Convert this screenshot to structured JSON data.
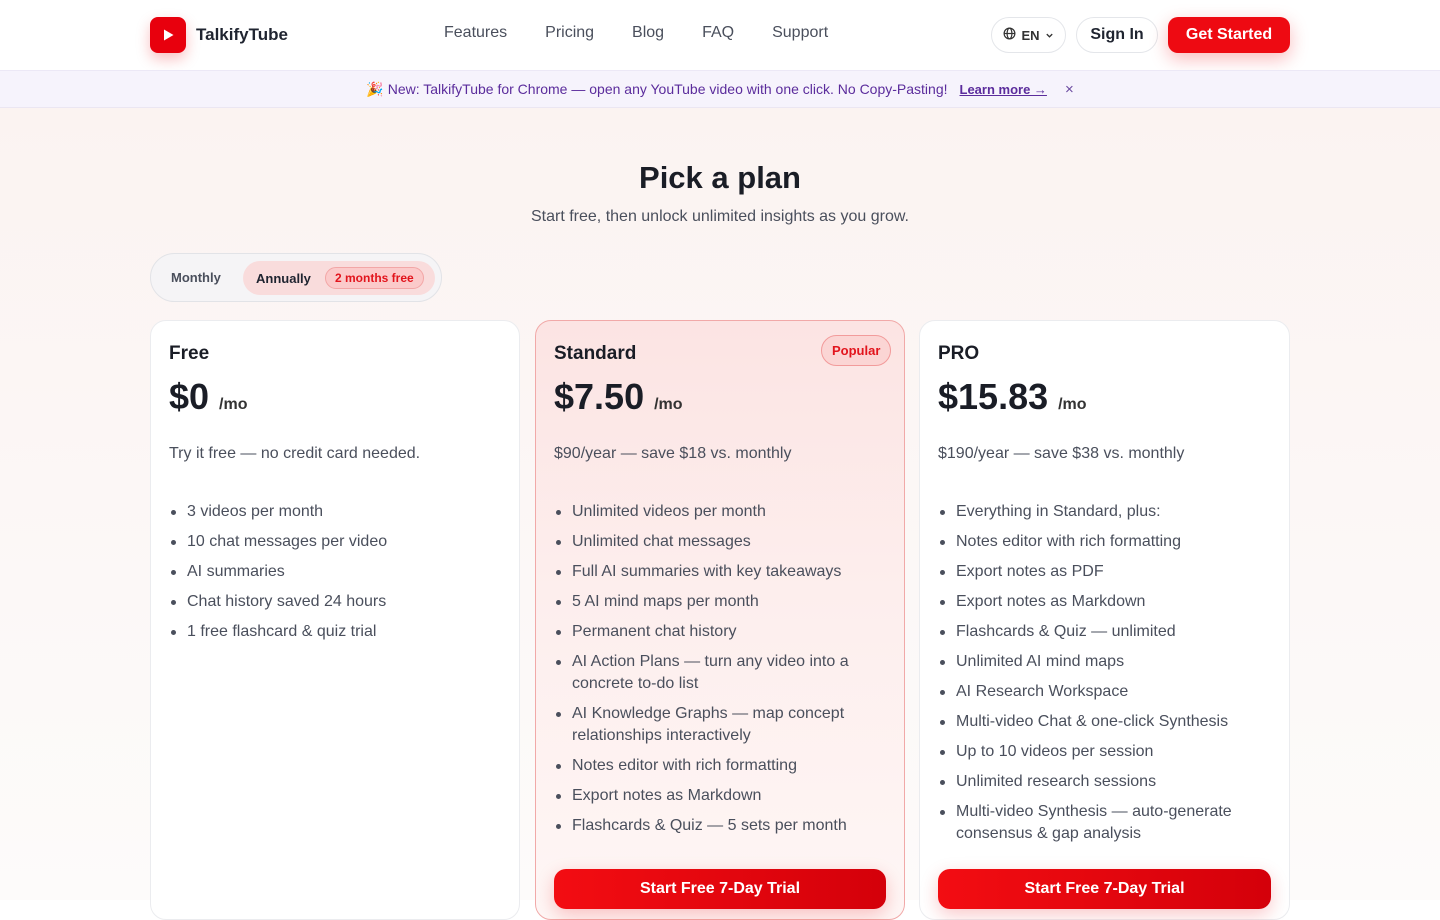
{
  "brand": {
    "name": "TalkifyTube",
    "accent": "#ee0a12"
  },
  "nav": {
    "items": [
      "Features",
      "Pricing",
      "Blog",
      "FAQ",
      "Support"
    ]
  },
  "header": {
    "language": "EN",
    "sign_in": "Sign In",
    "get_started": "Get Started"
  },
  "banner": {
    "emoji": "🎉",
    "text": "New: TalkifyTube for Chrome — open any YouTube video with one click. No Copy-Pasting!",
    "link": "Learn more →",
    "close": "×"
  },
  "page": {
    "title": "Pick a plan",
    "subtitle": "Start free, then unlock unlimited insights as you grow."
  },
  "billing_toggle": {
    "monthly": "Monthly",
    "annually": "Annually",
    "badge": "2 months free",
    "selected": "Annually"
  },
  "plans": [
    {
      "name": "Free",
      "price": "$0",
      "period": "/mo",
      "note": "Try it free — no credit card needed.",
      "features": [
        "3 videos per month",
        "10 chat messages per video",
        "AI summaries",
        "Chat history saved 24 hours",
        "1 free flashcard & quiz trial"
      ]
    },
    {
      "name": "Standard",
      "price": "$7.50",
      "period": "/mo",
      "badge": "Popular",
      "note": "$90/year — save $18 vs. monthly",
      "features": [
        "Unlimited videos per month",
        "Unlimited chat messages",
        "Full AI summaries with key takeaways",
        "5 AI mind maps per month",
        "Permanent chat history",
        "AI Action Plans — turn any video into a concrete to-do list",
        "AI Knowledge Graphs — map concept relationships interactively",
        "Notes editor with rich formatting",
        "Export notes as Markdown",
        "Flashcards & Quiz — 5 sets per month"
      ],
      "cta": "Start Free 7-Day Trial"
    },
    {
      "name": "PRO",
      "price": "$15.83",
      "period": "/mo",
      "note": "$190/year — save $38 vs. monthly",
      "features": [
        "Everything in Standard, plus:",
        "Notes editor with rich formatting",
        "Export notes as PDF",
        "Export notes as Markdown",
        "Flashcards & Quiz — unlimited",
        "Unlimited AI mind maps",
        "AI Research Workspace",
        "Multi-video Chat & one-click Synthesis",
        "Up to 10 videos per session",
        "Unlimited research sessions",
        "Multi-video Synthesis — auto-generate consensus & gap analysis"
      ],
      "cta": "Start Free 7-Day Trial"
    }
  ]
}
